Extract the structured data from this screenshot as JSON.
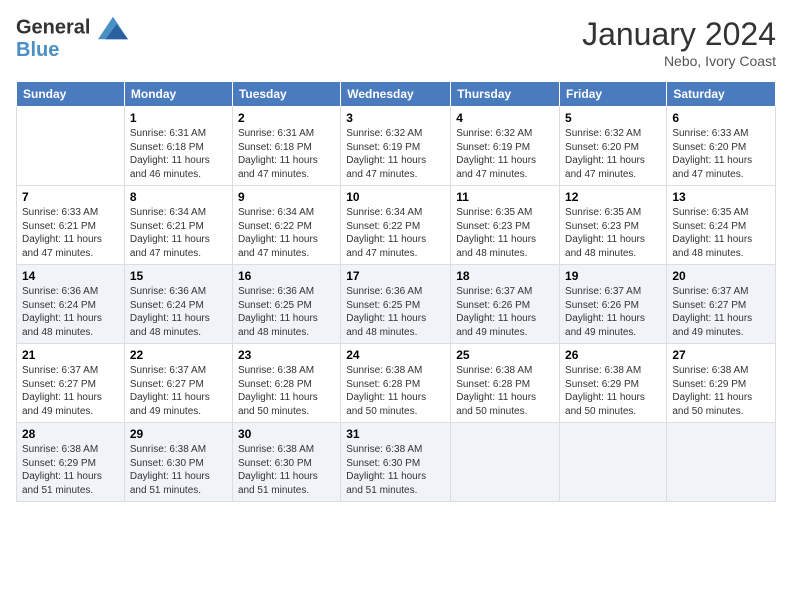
{
  "header": {
    "logo_line1": "General",
    "logo_line2": "Blue",
    "month": "January 2024",
    "location": "Nebo, Ivory Coast"
  },
  "days_of_week": [
    "Sunday",
    "Monday",
    "Tuesday",
    "Wednesday",
    "Thursday",
    "Friday",
    "Saturday"
  ],
  "weeks": [
    [
      {
        "day": "",
        "info": ""
      },
      {
        "day": "1",
        "info": "Sunrise: 6:31 AM\nSunset: 6:18 PM\nDaylight: 11 hours\nand 46 minutes."
      },
      {
        "day": "2",
        "info": "Sunrise: 6:31 AM\nSunset: 6:18 PM\nDaylight: 11 hours\nand 47 minutes."
      },
      {
        "day": "3",
        "info": "Sunrise: 6:32 AM\nSunset: 6:19 PM\nDaylight: 11 hours\nand 47 minutes."
      },
      {
        "day": "4",
        "info": "Sunrise: 6:32 AM\nSunset: 6:19 PM\nDaylight: 11 hours\nand 47 minutes."
      },
      {
        "day": "5",
        "info": "Sunrise: 6:32 AM\nSunset: 6:20 PM\nDaylight: 11 hours\nand 47 minutes."
      },
      {
        "day": "6",
        "info": "Sunrise: 6:33 AM\nSunset: 6:20 PM\nDaylight: 11 hours\nand 47 minutes."
      }
    ],
    [
      {
        "day": "7",
        "info": "Sunrise: 6:33 AM\nSunset: 6:21 PM\nDaylight: 11 hours\nand 47 minutes."
      },
      {
        "day": "8",
        "info": "Sunrise: 6:34 AM\nSunset: 6:21 PM\nDaylight: 11 hours\nand 47 minutes."
      },
      {
        "day": "9",
        "info": "Sunrise: 6:34 AM\nSunset: 6:22 PM\nDaylight: 11 hours\nand 47 minutes."
      },
      {
        "day": "10",
        "info": "Sunrise: 6:34 AM\nSunset: 6:22 PM\nDaylight: 11 hours\nand 47 minutes."
      },
      {
        "day": "11",
        "info": "Sunrise: 6:35 AM\nSunset: 6:23 PM\nDaylight: 11 hours\nand 48 minutes."
      },
      {
        "day": "12",
        "info": "Sunrise: 6:35 AM\nSunset: 6:23 PM\nDaylight: 11 hours\nand 48 minutes."
      },
      {
        "day": "13",
        "info": "Sunrise: 6:35 AM\nSunset: 6:24 PM\nDaylight: 11 hours\nand 48 minutes."
      }
    ],
    [
      {
        "day": "14",
        "info": "Sunrise: 6:36 AM\nSunset: 6:24 PM\nDaylight: 11 hours\nand 48 minutes."
      },
      {
        "day": "15",
        "info": "Sunrise: 6:36 AM\nSunset: 6:24 PM\nDaylight: 11 hours\nand 48 minutes."
      },
      {
        "day": "16",
        "info": "Sunrise: 6:36 AM\nSunset: 6:25 PM\nDaylight: 11 hours\nand 48 minutes."
      },
      {
        "day": "17",
        "info": "Sunrise: 6:36 AM\nSunset: 6:25 PM\nDaylight: 11 hours\nand 48 minutes."
      },
      {
        "day": "18",
        "info": "Sunrise: 6:37 AM\nSunset: 6:26 PM\nDaylight: 11 hours\nand 49 minutes."
      },
      {
        "day": "19",
        "info": "Sunrise: 6:37 AM\nSunset: 6:26 PM\nDaylight: 11 hours\nand 49 minutes."
      },
      {
        "day": "20",
        "info": "Sunrise: 6:37 AM\nSunset: 6:27 PM\nDaylight: 11 hours\nand 49 minutes."
      }
    ],
    [
      {
        "day": "21",
        "info": "Sunrise: 6:37 AM\nSunset: 6:27 PM\nDaylight: 11 hours\nand 49 minutes."
      },
      {
        "day": "22",
        "info": "Sunrise: 6:37 AM\nSunset: 6:27 PM\nDaylight: 11 hours\nand 49 minutes."
      },
      {
        "day": "23",
        "info": "Sunrise: 6:38 AM\nSunset: 6:28 PM\nDaylight: 11 hours\nand 50 minutes."
      },
      {
        "day": "24",
        "info": "Sunrise: 6:38 AM\nSunset: 6:28 PM\nDaylight: 11 hours\nand 50 minutes."
      },
      {
        "day": "25",
        "info": "Sunrise: 6:38 AM\nSunset: 6:28 PM\nDaylight: 11 hours\nand 50 minutes."
      },
      {
        "day": "26",
        "info": "Sunrise: 6:38 AM\nSunset: 6:29 PM\nDaylight: 11 hours\nand 50 minutes."
      },
      {
        "day": "27",
        "info": "Sunrise: 6:38 AM\nSunset: 6:29 PM\nDaylight: 11 hours\nand 50 minutes."
      }
    ],
    [
      {
        "day": "28",
        "info": "Sunrise: 6:38 AM\nSunset: 6:29 PM\nDaylight: 11 hours\nand 51 minutes."
      },
      {
        "day": "29",
        "info": "Sunrise: 6:38 AM\nSunset: 6:30 PM\nDaylight: 11 hours\nand 51 minutes."
      },
      {
        "day": "30",
        "info": "Sunrise: 6:38 AM\nSunset: 6:30 PM\nDaylight: 11 hours\nand 51 minutes."
      },
      {
        "day": "31",
        "info": "Sunrise: 6:38 AM\nSunset: 6:30 PM\nDaylight: 11 hours\nand 51 minutes."
      },
      {
        "day": "",
        "info": ""
      },
      {
        "day": "",
        "info": ""
      },
      {
        "day": "",
        "info": ""
      }
    ]
  ]
}
